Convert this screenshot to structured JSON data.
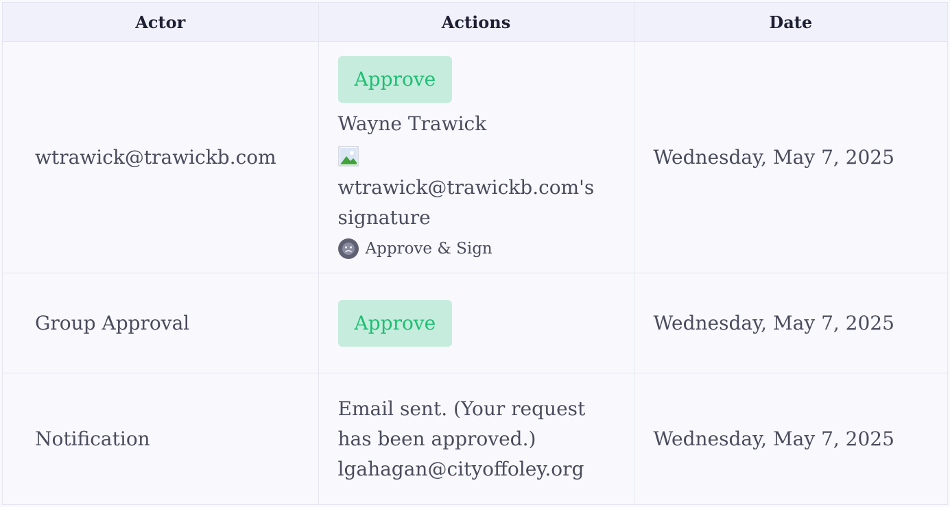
{
  "columns": {
    "actor": "Actor",
    "actions": "Actions",
    "date": "Date"
  },
  "rows": [
    {
      "actor": "wtrawick@trawickb.com",
      "badge": "Approve",
      "name": "Wayne Trawick",
      "signature_alt": "wtrawick@trawickb.com's signature",
      "action_type": "Approve & Sign",
      "date": "Wednesday, May 7, 2025"
    },
    {
      "actor": "Group Approval",
      "badge": "Approve",
      "date": "Wednesday, May 7, 2025"
    },
    {
      "actor": "Notification",
      "message": "Email sent. (Your request has been approved.)",
      "recipient": "lgahagan@cityoffoley.org",
      "date": "Wednesday, May 7, 2025"
    }
  ],
  "colors": {
    "approve_bg": "#c6ecdd",
    "approve_text": "#1dbf73",
    "header_bg": "#f1f1fb",
    "row_bg": "#f8f8fd"
  },
  "icons": {
    "broken_image": "broken-image-icon",
    "user": "user-avatar-icon"
  }
}
